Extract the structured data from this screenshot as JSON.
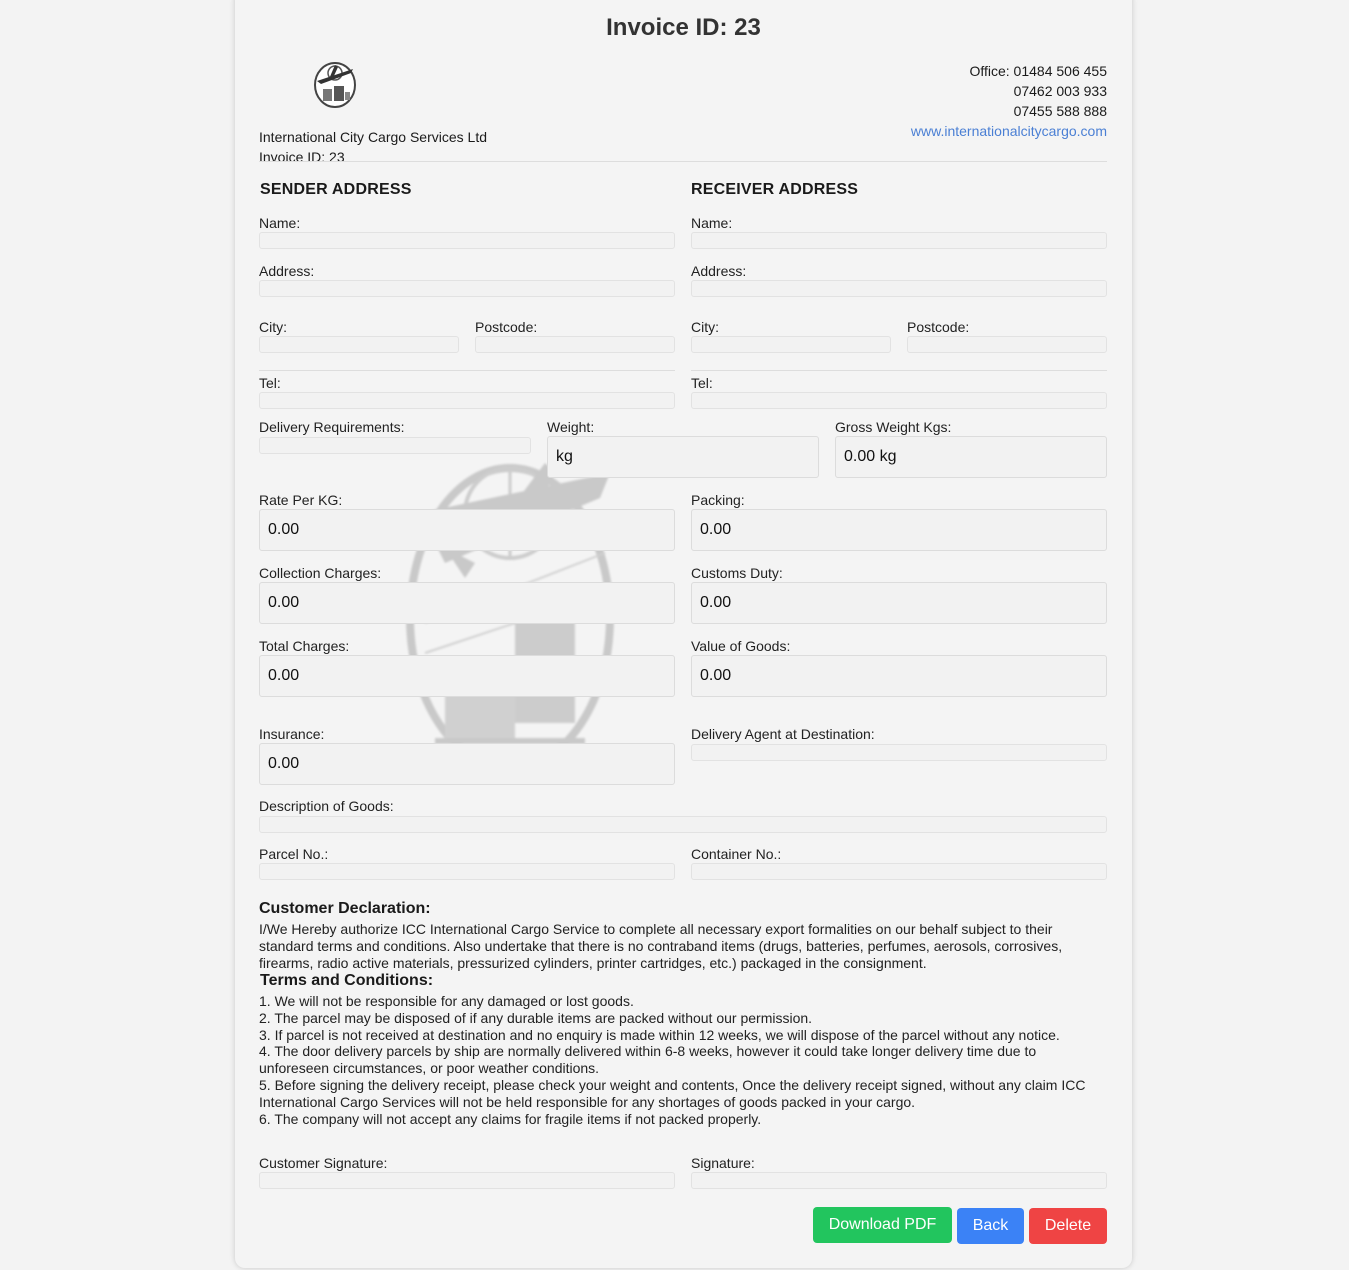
{
  "header": {
    "title": "Invoice ID: 23",
    "company_name": "International City Cargo Services Ltd",
    "invoice_line": "Invoice ID: 23",
    "office_phone": "Office: 01484 506 455",
    "phone_2": "07462 003 933",
    "phone_3": "07455 588 888",
    "website": "www.internationalcitycargo.com"
  },
  "sender": {
    "heading": "SENDER ADDRESS",
    "name_label": "Name:",
    "address_label": "Address:",
    "city_label": "City:",
    "postcode_label": "Postcode:",
    "tel_label": "Tel:"
  },
  "receiver": {
    "heading": "RECEIVER ADDRESS",
    "name_label": "Name:",
    "address_label": "Address:",
    "city_label": "City:",
    "postcode_label": "Postcode:",
    "tel_label": "Tel:"
  },
  "shipment": {
    "delivery_requirements_label": "Delivery Requirements:",
    "weight_label": "Weight:",
    "weight_value": "kg",
    "gross_weight_label": "Gross Weight Kgs:",
    "gross_weight_value": "0.00 kg",
    "rate_label": "Rate Per KG:",
    "rate_value": "0.00",
    "packing_label": "Packing:",
    "packing_value": "0.00",
    "collection_label": "Collection Charges:",
    "collection_value": "0.00",
    "customs_label": "Customs Duty:",
    "customs_value": "0.00",
    "total_label": "Total Charges:",
    "total_value": "0.00",
    "value_goods_label": "Value of Goods:",
    "value_goods_value": "0.00",
    "insurance_label": "Insurance:",
    "insurance_value": "0.00",
    "delivery_agent_label": "Delivery Agent at Destination:",
    "description_label": "Description of Goods:",
    "parcel_label": "Parcel No.:",
    "container_label": "Container No.:"
  },
  "declaration": {
    "heading": "Customer Declaration:",
    "text": "I/We Hereby authorize ICC International Cargo Service to complete all necessary export formalities on our behalf subject to their standard terms and conditions. Also undertake that there is no contraband items (drugs, batteries, perfumes, aerosols, corrosives, firearms, radio active materials, pressurized cylinders, printer cartridges, etc.) packaged in the consignment."
  },
  "terms": {
    "heading": "Terms and Conditions:",
    "items": [
      "1. We will not be responsible for any damaged or lost goods.",
      "2. The parcel may be disposed of if any durable items are packed without our permission.",
      "3. If parcel is not received at destination and no enquiry is made within 12 weeks, we will dispose of the parcel without any notice.",
      "4. The door delivery parcels by ship are normally delivered within 6-8 weeks, however it could take longer delivery time due to unforeseen circumstances, or poor weather conditions.",
      "5. Before signing the delivery receipt, please check your weight and contents, Once the delivery receipt signed, without any claim ICC International Cargo Services will not be held responsible for any shortages of goods packed in your cargo.",
      "6. The company will not accept any claims for fragile items if not packed properly."
    ]
  },
  "signatures": {
    "customer_label": "Customer Signature:",
    "signature_label": "Signature:"
  },
  "actions": {
    "download_label": "Download PDF",
    "back_label": "Back",
    "delete_label": "Delete"
  },
  "colors": {
    "download": "#22c55e",
    "back": "#3b82f6",
    "delete": "#ef4444",
    "link": "#4a7fd4"
  }
}
